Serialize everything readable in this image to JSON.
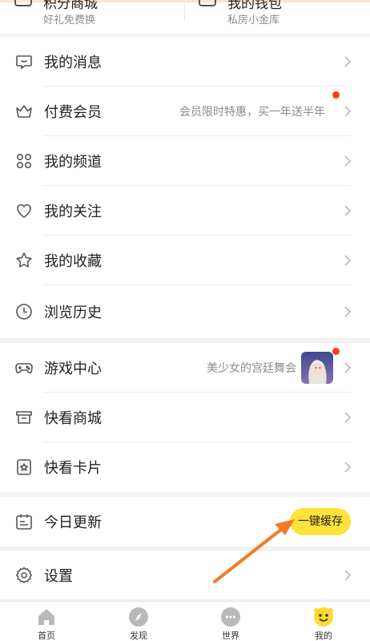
{
  "top_shortcuts": [
    {
      "title": "积分商城",
      "subtitle": "好礼免费换",
      "icon": "gift-icon"
    },
    {
      "title": "我的钱包",
      "subtitle": "私房小金库",
      "icon": "wallet-icon"
    }
  ],
  "menu_group_1": [
    {
      "label": "我的消息",
      "icon": "message-icon",
      "note": ""
    },
    {
      "label": "付费会员",
      "icon": "crown-icon",
      "note": "会员限时特惠，买一年送半年",
      "badge": "red-dot"
    },
    {
      "label": "我的频道",
      "icon": "grid-icon",
      "note": ""
    },
    {
      "label": "我的关注",
      "icon": "heart-icon",
      "note": ""
    },
    {
      "label": "我的收藏",
      "icon": "star-icon",
      "note": ""
    },
    {
      "label": "浏览历史",
      "icon": "clock-icon",
      "note": ""
    }
  ],
  "menu_group_2": [
    {
      "label": "游戏中心",
      "icon": "gamepad-icon",
      "note": "美少女的宫廷舞会",
      "badge": "red-dot",
      "thumbnail": "game-thumbnail"
    },
    {
      "label": "快看商城",
      "icon": "store-icon",
      "note": ""
    },
    {
      "label": "快看卡片",
      "icon": "card-icon",
      "note": ""
    }
  ],
  "today_update": {
    "label": "今日更新",
    "icon": "calendar-icon",
    "button": "一键缓存"
  },
  "settings": {
    "label": "设置",
    "icon": "settings-icon"
  },
  "tabbar": [
    {
      "label": "首页",
      "icon": "home-icon",
      "active": false
    },
    {
      "label": "发现",
      "icon": "discover-icon",
      "active": false
    },
    {
      "label": "世界",
      "icon": "world-icon",
      "active": false
    },
    {
      "label": "我的",
      "icon": "me-icon",
      "active": true
    }
  ],
  "colors": {
    "accent_yellow": "#ffe23a",
    "badge_red": "#ff3b22",
    "annotation_arrow": "#f47b25",
    "text_secondary": "#8b8b8b"
  }
}
